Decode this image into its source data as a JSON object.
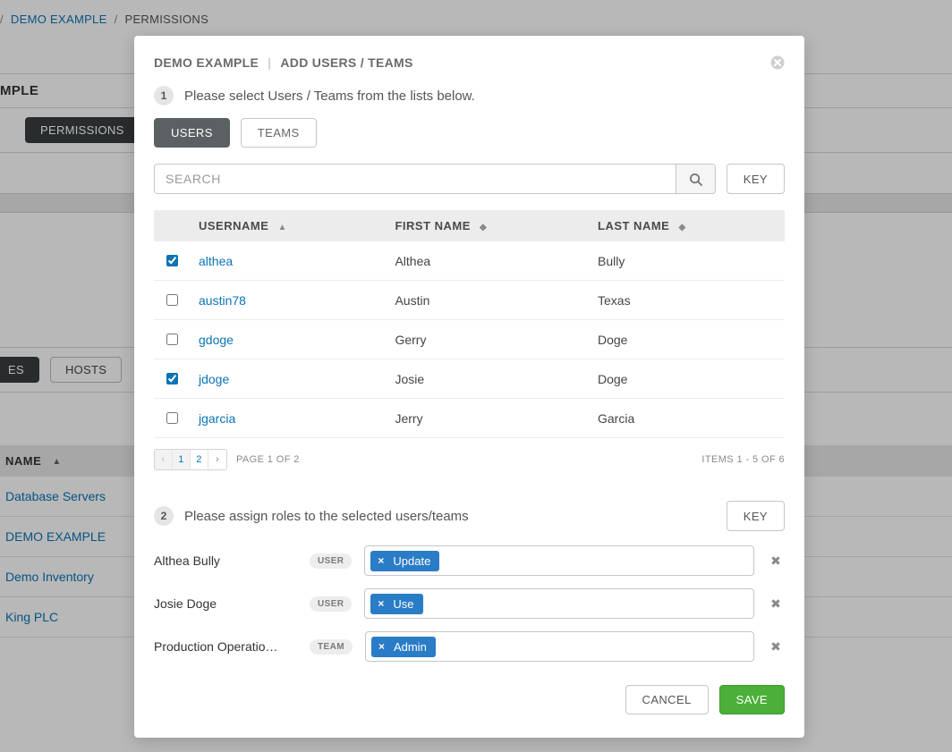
{
  "breadcrumb": {
    "item1": "DEMO EXAMPLE",
    "item2": "PERMISSIONS"
  },
  "bg": {
    "title_fragment": "MPLE",
    "pills": {
      "es": "ES",
      "permissions": "PERMISSIONS",
      "hosts": "HOSTS"
    },
    "table": {
      "header": "NAME",
      "rows": [
        "Database Servers",
        "DEMO EXAMPLE",
        "Demo Inventory",
        "King PLC"
      ]
    }
  },
  "modal": {
    "title1": "DEMO EXAMPLE",
    "title2": "ADD USERS / TEAMS",
    "step1_text": "Please select Users / Teams from the lists below.",
    "step2_text": "Please assign roles to the selected users/teams",
    "tabs": {
      "users": "USERS",
      "teams": "TEAMS"
    },
    "search_placeholder": "SEARCH",
    "key_label": "KEY",
    "columns": {
      "username": "USERNAME",
      "first": "FIRST NAME",
      "last": "LAST NAME"
    },
    "users": [
      {
        "checked": true,
        "username": "althea",
        "first": "Althea",
        "last": "Bully"
      },
      {
        "checked": false,
        "username": "austin78",
        "first": "Austin",
        "last": "Texas"
      },
      {
        "checked": false,
        "username": "gdoge",
        "first": "Gerry",
        "last": "Doge"
      },
      {
        "checked": true,
        "username": "jdoge",
        "first": "Josie",
        "last": "Doge"
      },
      {
        "checked": false,
        "username": "jgarcia",
        "first": "Jerry",
        "last": "Garcia"
      }
    ],
    "pager": {
      "p1": "1",
      "p2": "2",
      "page_text": "PAGE 1 OF 2",
      "items_text": "ITEMS  1 - 5 OF 6"
    },
    "assignments": [
      {
        "name": "Althea Bully",
        "badge": "USER",
        "role": "Update"
      },
      {
        "name": "Josie Doge",
        "badge": "USER",
        "role": "Use"
      },
      {
        "name": "Production Operatio…",
        "badge": "TEAM",
        "role": "Admin"
      }
    ],
    "buttons": {
      "cancel": "CANCEL",
      "save": "SAVE"
    },
    "step1_num": "1",
    "step2_num": "2"
  }
}
